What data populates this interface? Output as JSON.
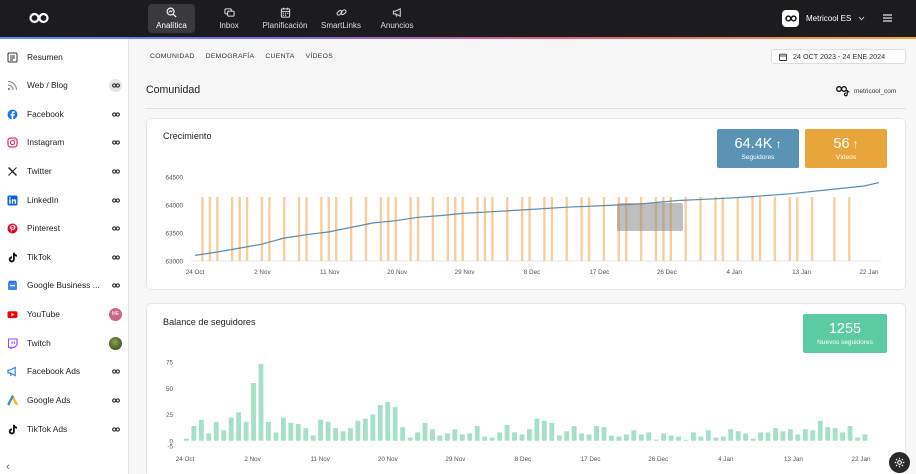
{
  "topbar": {
    "nav": [
      {
        "label": "Analítica",
        "icon": "analytics-icon",
        "active": true
      },
      {
        "label": "Inbox",
        "icon": "inbox-icon",
        "active": false
      },
      {
        "label": "Planificación",
        "icon": "calendar-icon",
        "active": false
      },
      {
        "label": "SmartLinks",
        "icon": "link-icon",
        "active": false
      },
      {
        "label": "Anuncios",
        "icon": "megaphone-icon",
        "active": false
      }
    ],
    "account_name": "Metricool ES"
  },
  "sidebar": {
    "items": [
      {
        "label": "Resumen",
        "icon": "summary-icon",
        "color": "#333333",
        "badge": ""
      },
      {
        "label": "Web / Blog",
        "icon": "rss-icon",
        "color": "#888888",
        "badge": "metricool"
      },
      {
        "label": "Facebook",
        "icon": "facebook-icon",
        "color": "#1877f2",
        "badge": "metricool"
      },
      {
        "label": "Instagram",
        "icon": "instagram-icon",
        "color": "#e1306c",
        "badge": "metricool"
      },
      {
        "label": "Twitter",
        "icon": "x-icon",
        "color": "#222222",
        "badge": "metricool"
      },
      {
        "label": "LinkedIn",
        "icon": "linkedin-icon",
        "color": "#0a66c2",
        "badge": "metricool"
      },
      {
        "label": "Pinterest",
        "icon": "pinterest-icon",
        "color": "#e60023",
        "badge": "metricool"
      },
      {
        "label": "TikTok",
        "icon": "tiktok-icon",
        "color": "#111111",
        "badge": "metricool"
      },
      {
        "label": "Google Business ...",
        "icon": "google-business-icon",
        "color": "#4285f4",
        "badge": "metricool"
      },
      {
        "label": "YouTube",
        "icon": "youtube-icon",
        "color": "#ff0000",
        "badge": "ME"
      },
      {
        "label": "Twitch",
        "icon": "twitch-icon",
        "color": "#9146ff",
        "badge": "avatar"
      },
      {
        "label": "Facebook Ads",
        "icon": "facebook-ads-icon",
        "color": "#1877f2",
        "badge": "metricool"
      },
      {
        "label": "Google Ads",
        "icon": "google-ads-icon",
        "color": "#34a853",
        "badge": "metricool"
      },
      {
        "label": "TikTok Ads",
        "icon": "tiktok-ads-icon",
        "color": "#111111",
        "badge": "metricool"
      }
    ]
  },
  "subtabs": [
    "COMUNIDAD",
    "DEMOGRAFÍA",
    "CUENTA",
    "VÍDEOS"
  ],
  "date_range": "24 OCT 2023 - 24 ENE 2024",
  "page_title": "Comunidad",
  "account_handle": "metricool_com",
  "growth_card": {
    "title": "Crecimiento",
    "followers": {
      "value": "64.4K",
      "label": "Seguidores",
      "color": "#5a93b4"
    },
    "videos": {
      "value": "56",
      "label": "Vídeos",
      "color": "#e8a53c"
    }
  },
  "balance_card": {
    "title": "Balance de seguidores",
    "new_followers": {
      "value": "1255",
      "label": "Nuevos seguidores",
      "color": "#5ccaa3"
    }
  },
  "chart_data": [
    {
      "type": "line",
      "title": "Crecimiento",
      "x_ticks": [
        "24 Oct",
        "2 Nov",
        "11 Nov",
        "20 Nov",
        "29 Nov",
        "8 Dec",
        "17 Dec",
        "26 Dec",
        "4 Jan",
        "13 Jan",
        "22 Jan"
      ],
      "y_ticks": [
        63000,
        63500,
        64000,
        64500
      ],
      "ylim": [
        63000,
        64500
      ],
      "series": [
        {
          "name": "Seguidores",
          "type": "line",
          "color": "#5a8db0",
          "x": [
            0,
            3,
            6,
            9,
            12,
            15,
            18,
            21,
            24,
            27,
            30,
            33,
            36,
            40,
            45,
            50,
            55,
            60,
            65,
            70,
            75,
            80,
            85,
            90,
            92
          ],
          "values": [
            63100,
            63160,
            63230,
            63300,
            63410,
            63470,
            63520,
            63600,
            63680,
            63720,
            63780,
            63810,
            63850,
            63880,
            63920,
            63960,
            63990,
            64020,
            64080,
            64110,
            64150,
            64200,
            64270,
            64340,
            64400
          ]
        },
        {
          "name": "Vídeos",
          "type": "bar",
          "color": "#f5cfa0",
          "x": [
            1,
            2,
            3,
            5,
            6,
            7,
            9,
            10,
            12,
            14,
            15,
            17,
            18,
            19,
            21,
            23,
            25,
            26,
            27,
            29,
            30,
            32,
            34,
            35,
            36,
            38,
            39,
            40,
            42,
            44,
            45,
            47,
            48,
            50,
            52,
            53,
            55,
            57,
            58,
            60,
            62,
            63,
            64,
            66,
            68,
            70,
            71,
            73,
            75,
            76,
            78,
            80,
            81,
            83,
            86,
            88
          ],
          "values": [
            1,
            1,
            1,
            1,
            1,
            1,
            1,
            1,
            1,
            1,
            1,
            1,
            1,
            1,
            1,
            1,
            1,
            1,
            1,
            1,
            1,
            1,
            1,
            1,
            1,
            1,
            1,
            1,
            1,
            1,
            1,
            1,
            1,
            1,
            1,
            1,
            1,
            1,
            1,
            1,
            1,
            1,
            1,
            1,
            1,
            1,
            1,
            1,
            1,
            1,
            1,
            1,
            1,
            1,
            1,
            1
          ]
        }
      ],
      "tooltip_note": "Hover tooltip faintly visible near 20 Dec"
    },
    {
      "type": "bar",
      "title": "Balance de seguidores",
      "x_ticks": [
        "24 Oct",
        "2 Nov",
        "11 Nov",
        "20 Nov",
        "29 Nov",
        "8 Dec",
        "17 Dec",
        "26 Dec",
        "4 Jan",
        "13 Jan",
        "22 Jan"
      ],
      "y_ticks": [
        -5,
        0,
        25,
        50,
        75
      ],
      "ylim": [
        -5,
        75
      ],
      "series": [
        {
          "name": "Nuevos seguidores",
          "color": "#a6e0c7",
          "values": [
            2,
            14,
            20,
            7,
            18,
            10,
            22,
            27,
            18,
            55,
            73,
            18,
            8,
            22,
            17,
            16,
            12,
            5,
            20,
            18,
            12,
            9,
            12,
            19,
            21,
            25,
            34,
            37,
            32,
            13,
            3,
            8,
            17,
            11,
            5,
            7,
            11,
            6,
            7,
            14,
            4,
            3,
            8,
            15,
            8,
            6,
            11,
            21,
            19,
            17,
            5,
            9,
            14,
            7,
            6,
            14,
            13,
            5,
            4,
            6,
            10,
            6,
            8,
            1,
            7,
            5,
            4,
            1,
            8,
            4,
            10,
            3,
            4,
            11,
            9,
            7,
            2,
            8,
            8,
            12,
            9,
            11,
            6,
            11,
            10,
            19,
            13,
            12,
            8,
            14,
            3,
            6
          ]
        }
      ]
    }
  ]
}
